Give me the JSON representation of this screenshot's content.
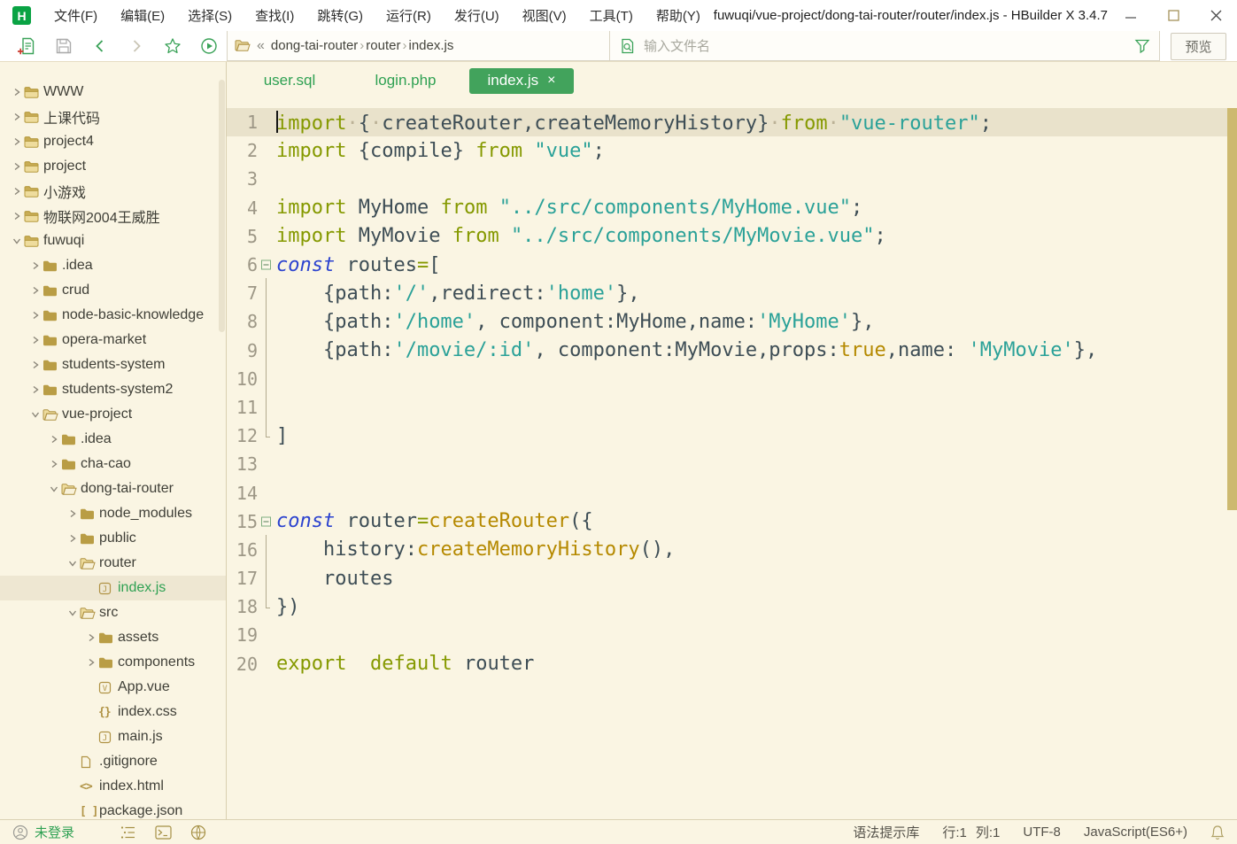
{
  "titlebar": {
    "logo": "H",
    "menus": [
      "文件(F)",
      "编辑(E)",
      "选择(S)",
      "查找(I)",
      "跳转(G)",
      "运行(R)",
      "发行(U)",
      "视图(V)",
      "工具(T)",
      "帮助(Y)"
    ],
    "title": "fuwuqi/vue-project/dong-tai-router/router/index.js - HBuilder X 3.4.7"
  },
  "toolbar": {
    "breadcrumb": {
      "collapse": "«",
      "separator": "›",
      "items": [
        "dong-tai-router",
        "router",
        "index.js"
      ]
    },
    "search_placeholder": "输入文件名",
    "preview_label": "预览"
  },
  "sidebar": {
    "items": [
      {
        "label": "WWW",
        "level": 0,
        "expand": "closed",
        "icon": "folder-root"
      },
      {
        "label": "上课代码",
        "level": 0,
        "expand": "closed",
        "icon": "folder-root"
      },
      {
        "label": "project4",
        "level": 0,
        "expand": "closed",
        "icon": "folder-root"
      },
      {
        "label": "project",
        "level": 0,
        "expand": "closed",
        "icon": "folder-root"
      },
      {
        "label": "小游戏",
        "level": 0,
        "expand": "closed",
        "icon": "folder-root"
      },
      {
        "label": "物联网2004王威胜",
        "level": 0,
        "expand": "closed",
        "icon": "folder-root"
      },
      {
        "label": "fuwuqi",
        "level": 0,
        "expand": "open",
        "icon": "folder-root"
      },
      {
        "label": ".idea",
        "level": 1,
        "expand": "closed",
        "icon": "folder"
      },
      {
        "label": "crud",
        "level": 1,
        "expand": "closed",
        "icon": "folder"
      },
      {
        "label": "node-basic-knowledge",
        "level": 1,
        "expand": "closed",
        "icon": "folder"
      },
      {
        "label": "opera-market",
        "level": 1,
        "expand": "closed",
        "icon": "folder"
      },
      {
        "label": "students-system",
        "level": 1,
        "expand": "closed",
        "icon": "folder"
      },
      {
        "label": "students-system2",
        "level": 1,
        "expand": "closed",
        "icon": "folder"
      },
      {
        "label": "vue-project",
        "level": 1,
        "expand": "open",
        "icon": "folder-open"
      },
      {
        "label": ".idea",
        "level": 2,
        "expand": "closed",
        "icon": "folder"
      },
      {
        "label": "cha-cao",
        "level": 2,
        "expand": "closed",
        "icon": "folder"
      },
      {
        "label": "dong-tai-router",
        "level": 2,
        "expand": "open",
        "icon": "folder-open"
      },
      {
        "label": "node_modules",
        "level": 3,
        "expand": "closed",
        "icon": "folder"
      },
      {
        "label": "public",
        "level": 3,
        "expand": "closed",
        "icon": "folder"
      },
      {
        "label": "router",
        "level": 3,
        "expand": "open",
        "icon": "folder-open"
      },
      {
        "label": "index.js",
        "level": 4,
        "expand": null,
        "icon": "js",
        "selected": true
      },
      {
        "label": "src",
        "level": 3,
        "expand": "open",
        "icon": "folder-open"
      },
      {
        "label": "assets",
        "level": 4,
        "expand": "closed",
        "icon": "folder"
      },
      {
        "label": "components",
        "level": 4,
        "expand": "closed",
        "icon": "folder"
      },
      {
        "label": "App.vue",
        "level": 4,
        "expand": null,
        "icon": "vue"
      },
      {
        "label": "index.css",
        "level": 4,
        "expand": null,
        "icon": "css"
      },
      {
        "label": "main.js",
        "level": 4,
        "expand": null,
        "icon": "js"
      },
      {
        "label": ".gitignore",
        "level": 3,
        "expand": null,
        "icon": "file"
      },
      {
        "label": "index.html",
        "level": 3,
        "expand": null,
        "icon": "html"
      },
      {
        "label": "package.json",
        "level": 3,
        "expand": null,
        "icon": "json"
      }
    ]
  },
  "tabs": [
    {
      "label": "user.sql",
      "active": false
    },
    {
      "label": "login.php",
      "active": false
    },
    {
      "label": "index.js",
      "active": true,
      "close": "×"
    }
  ],
  "editor": {
    "lines": [
      {
        "num": 1,
        "current": true,
        "cursor": true,
        "tokens": [
          [
            "k",
            "import"
          ],
          [
            "w",
            "·"
          ],
          [
            "p",
            "{"
          ],
          [
            "w",
            "·"
          ],
          [
            "p",
            "createRouter,createMemoryHistory}"
          ],
          [
            "w",
            "·"
          ],
          [
            "k",
            "from"
          ],
          [
            "w",
            "·"
          ],
          [
            "s",
            "\"vue-router\""
          ],
          [
            "p",
            ";"
          ]
        ]
      },
      {
        "num": 2,
        "tokens": [
          [
            "k",
            "import"
          ],
          [
            "p",
            " {compile} "
          ],
          [
            "k",
            "from"
          ],
          [
            "p",
            " "
          ],
          [
            "s",
            "\"vue\""
          ],
          [
            "p",
            ";"
          ]
        ]
      },
      {
        "num": 3,
        "tokens": []
      },
      {
        "num": 4,
        "tokens": [
          [
            "k",
            "import"
          ],
          [
            "p",
            " MyHome "
          ],
          [
            "k",
            "from"
          ],
          [
            "p",
            " "
          ],
          [
            "s",
            "\"../src/components/MyHome.vue\""
          ],
          [
            "p",
            ";"
          ]
        ]
      },
      {
        "num": 5,
        "tokens": [
          [
            "k",
            "import"
          ],
          [
            "p",
            " MyMovie "
          ],
          [
            "k",
            "from"
          ],
          [
            "p",
            " "
          ],
          [
            "s",
            "\"../src/components/MyMovie.vue\""
          ],
          [
            "p",
            ";"
          ]
        ]
      },
      {
        "num": 6,
        "fold": "open",
        "tokens": [
          [
            "c",
            "const"
          ],
          [
            "p",
            " routes"
          ],
          [
            "o",
            "="
          ],
          [
            "p",
            "["
          ]
        ]
      },
      {
        "num": 7,
        "guide": "mid",
        "tokens": [
          [
            "p",
            "    {path:"
          ],
          [
            "s",
            "'/'"
          ],
          [
            "p",
            ",redirect:"
          ],
          [
            "s",
            "'home'"
          ],
          [
            "p",
            "},"
          ]
        ]
      },
      {
        "num": 8,
        "guide": "mid",
        "tokens": [
          [
            "p",
            "    {path:"
          ],
          [
            "s",
            "'/home'"
          ],
          [
            "p",
            ", component:MyHome,name:"
          ],
          [
            "s",
            "'MyHome'"
          ],
          [
            "p",
            "},"
          ]
        ]
      },
      {
        "num": 9,
        "guide": "mid",
        "tokens": [
          [
            "p",
            "    {path:"
          ],
          [
            "s",
            "'/movie/:id'"
          ],
          [
            "p",
            ", component:MyMovie,props:"
          ],
          [
            "b",
            "true"
          ],
          [
            "p",
            ",name: "
          ],
          [
            "s",
            "'MyMovie'"
          ],
          [
            "p",
            "},"
          ]
        ]
      },
      {
        "num": 10,
        "guide": "mid",
        "tokens": []
      },
      {
        "num": 11,
        "guide": "mid",
        "tokens": []
      },
      {
        "num": 12,
        "guide": "end",
        "tokens": [
          [
            "p",
            "]"
          ]
        ]
      },
      {
        "num": 13,
        "tokens": []
      },
      {
        "num": 14,
        "tokens": []
      },
      {
        "num": 15,
        "fold": "open",
        "tokens": [
          [
            "c",
            "const"
          ],
          [
            "p",
            " router"
          ],
          [
            "o",
            "="
          ],
          [
            "f",
            "createRouter"
          ],
          [
            "p",
            "({"
          ]
        ]
      },
      {
        "num": 16,
        "guide": "mid",
        "tokens": [
          [
            "p",
            "    history:"
          ],
          [
            "f",
            "createMemoryHistory"
          ],
          [
            "p",
            "(),"
          ]
        ]
      },
      {
        "num": 17,
        "guide": "mid",
        "tokens": [
          [
            "p",
            "    routes"
          ]
        ]
      },
      {
        "num": 18,
        "guide": "end",
        "tokens": [
          [
            "p",
            "})"
          ]
        ]
      },
      {
        "num": 19,
        "tokens": []
      },
      {
        "num": 20,
        "tokens": [
          [
            "k",
            "export"
          ],
          [
            "p",
            "  "
          ],
          [
            "k",
            "default"
          ],
          [
            "p",
            " router"
          ]
        ]
      }
    ]
  },
  "statusbar": {
    "login": "未登录",
    "syntax_lib": "语法提示库",
    "line": "行:1",
    "column": "列:1",
    "encoding": "UTF-8",
    "language": "JavaScript(ES6+)"
  },
  "colors": {
    "accent_green": "#2fa153",
    "tab_active_bg": "#42a35c",
    "logo_green": "#0aa344",
    "editor_bg": "#faf5e3",
    "current_line_bg": "#e9e2cb",
    "selected_row_bg": "#eee7d2",
    "keyword_olive": "#859900",
    "string_teal": "#2aa198",
    "declaration_blue": "#2c43cf",
    "function_gold": "#b58900",
    "plain_text": "#3d4d55",
    "line_number_gray": "#9d9786",
    "scrollbar_thumb": "#cdb96f",
    "folder_gold": "#b09345"
  }
}
